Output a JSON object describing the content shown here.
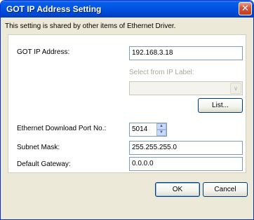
{
  "window": {
    "title": "GOT IP Address Setting",
    "close_glyph": "✕"
  },
  "info_text": "This setting is shared by other items of Ethernet Driver.",
  "form": {
    "got_ip": {
      "label": "GOT IP Address:",
      "value": "192.168.3.18"
    },
    "select_label": {
      "label": "Select from IP Label:",
      "selected": ""
    },
    "list_button": "List...",
    "download_port": {
      "label": "Ethernet Download Port No.:",
      "value": "5014"
    },
    "subnet": {
      "label": "Subnet Mask:",
      "value": "255.255.255.0"
    },
    "gateway": {
      "label": "Default Gateway:",
      "value": "0.0.0.0"
    }
  },
  "buttons": {
    "ok": "OK",
    "cancel": "Cancel"
  },
  "icons": {
    "combo_arrow": "chevron-down-icon",
    "spin_up": "triangle-up-icon",
    "spin_down": "triangle-down-icon"
  },
  "colors": {
    "titlebar": "#0054e3",
    "close": "#d6553a",
    "dialog_bg": "#ece9d8"
  }
}
